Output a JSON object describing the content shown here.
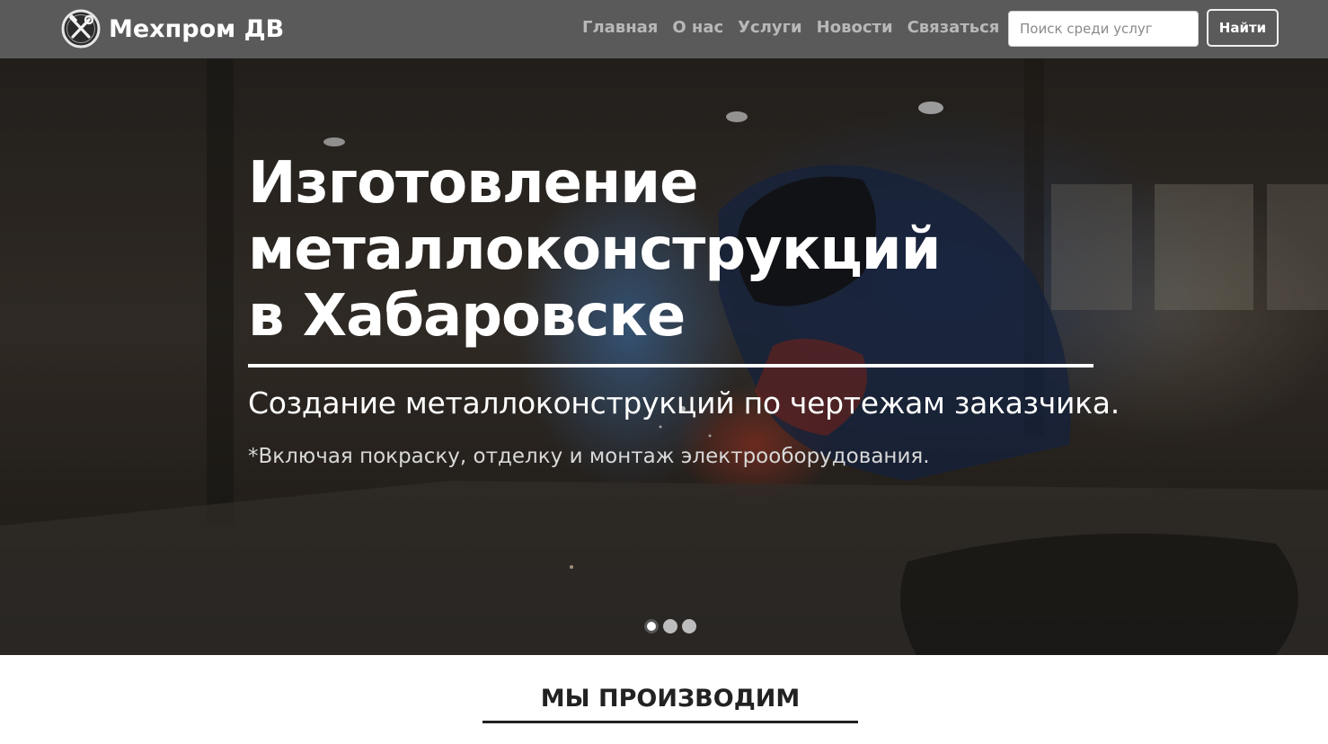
{
  "header": {
    "brand_name": "Мехпром ДВ",
    "logo_icon": "wrench-hammer-logo-icon",
    "nav": [
      {
        "label": "Главная"
      },
      {
        "label": "О нас"
      },
      {
        "label": "Услуги"
      },
      {
        "label": "Новости"
      },
      {
        "label": "Связаться"
      }
    ],
    "search": {
      "placeholder": "Поиск среди услуг",
      "value": ""
    },
    "search_button_label": "Найти"
  },
  "hero": {
    "title_lines": [
      "Изготовление",
      "металлоконструкций",
      "в Хабаровске"
    ],
    "subtitle": "Создание металлоконструкций по чертежам заказчика.",
    "note": "*Включая покраску, отделку и монтаж электрооборудования.",
    "carousel": {
      "slide_count": 3,
      "active_index": 0
    }
  },
  "section": {
    "title": "МЫ ПРОИЗВОДИМ"
  },
  "colors": {
    "navbar_bg": "#5a5a5a",
    "nav_link": "#b8b8b8",
    "hero_text": "#ffffff"
  }
}
